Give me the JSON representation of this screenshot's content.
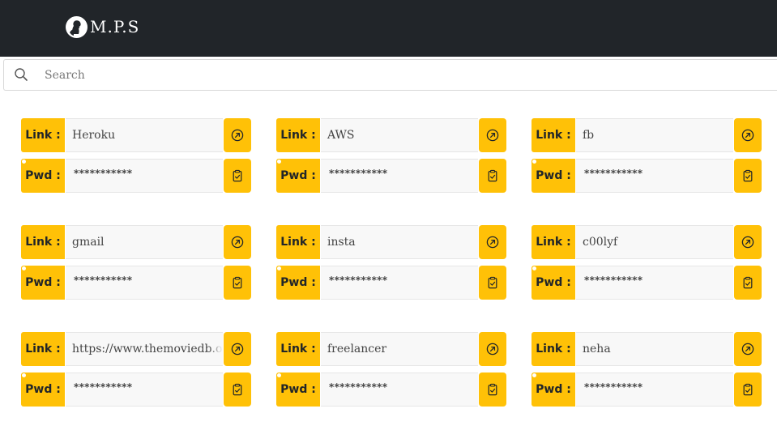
{
  "navbar": {
    "brand_name": "M.P.S",
    "logo_icon": "silhouette-logo-icon",
    "background": "#212529"
  },
  "search": {
    "placeholder": "Search",
    "value": "",
    "icon": "search-icon"
  },
  "colors": {
    "accent": "#ffc107",
    "field_bg": "#f8f8f8"
  },
  "labels": {
    "link": "Link :",
    "pwd": "Pwd :"
  },
  "icons": {
    "open_link": "arrow-up-right-circle-icon",
    "copy": "clipboard-check-icon"
  },
  "entries": [
    {
      "link": "Heroku",
      "password": "***********"
    },
    {
      "link": "AWS",
      "password": "***********"
    },
    {
      "link": "fb",
      "password": "***********"
    },
    {
      "link": "gmail",
      "password": "***********"
    },
    {
      "link": "insta",
      "password": "***********"
    },
    {
      "link": "c00lyf",
      "password": "***********"
    },
    {
      "link": "https://www.themoviedb.org",
      "password": "***********"
    },
    {
      "link": "freelancer",
      "password": "***********"
    },
    {
      "link": "neha",
      "password": "***********"
    }
  ]
}
